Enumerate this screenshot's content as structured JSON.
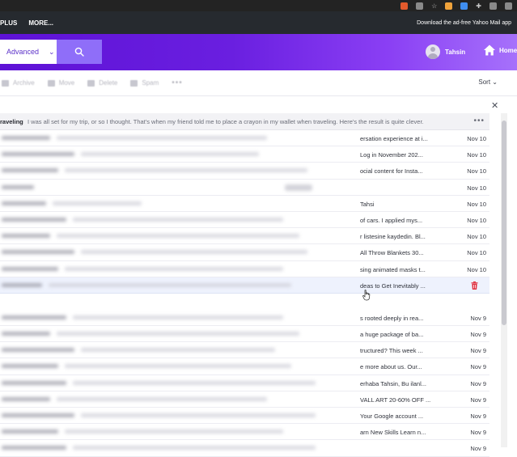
{
  "browser": {
    "icons": [
      "extension-icon",
      "share-icon",
      "star-icon",
      "metamask-icon",
      "pdf-icon",
      "puzzle-icon",
      "window-icon",
      "profile-icon"
    ]
  },
  "nav": {
    "links": [
      "PLUS",
      "MORE..."
    ],
    "ad_free": "Download the ad-free Yahoo Mail app"
  },
  "header": {
    "search_mode": "Advanced",
    "user_name": "Tahsin",
    "home_label": "Home",
    "colors": {
      "start": "#5e12d6",
      "end": "#a671fb",
      "search_button": "#8f6ef9"
    }
  },
  "toolbar": {
    "archive": "Archive",
    "move": "Move",
    "delete": "Delete",
    "spam": "Spam",
    "more": "•••",
    "sort": "Sort"
  },
  "open_message": {
    "subject": "raveling",
    "preview": "I was all set for my trip, or so I thought. That's when my friend told me to place a crayon in my wallet when traveling. Here's the result is quite clever.",
    "more": "•••"
  },
  "messages": [
    {
      "snippet": "ersation experience at i...",
      "date": "Nov 10"
    },
    {
      "snippet": "Log in November 202...",
      "date": "Nov 10"
    },
    {
      "snippet": "ocial content for Insta...",
      "date": "Nov 10"
    },
    {
      "snippet": "",
      "date": "Nov 10"
    },
    {
      "snippet": "Tahsi",
      "date": "Nov 10"
    },
    {
      "snippet": "of cars. I applied mys...",
      "date": "Nov 10"
    },
    {
      "snippet": "r listesine kaydedin. Bl...",
      "date": "Nov 10"
    },
    {
      "snippet": "All Throw Blankets 30...",
      "date": "Nov 10"
    },
    {
      "snippet": "sing animated masks t...",
      "date": "Nov 10"
    },
    {
      "snippet": "deas to Get Inevitably ...",
      "date": ""
    },
    {
      "snippet": "",
      "date": ""
    },
    {
      "snippet": "s rooted deeply in rea...",
      "date": "Nov 9"
    },
    {
      "snippet": "a huge package of ba...",
      "date": "Nov 9"
    },
    {
      "snippet": "tructured? This week ...",
      "date": "Nov 9"
    },
    {
      "snippet": "e more about us. Our...",
      "date": "Nov 9"
    },
    {
      "snippet": "erhaba Tahsin, Bu ilanl...",
      "date": "Nov 9"
    },
    {
      "snippet": "VALL ART 20-60% OFF ...",
      "date": "Nov 9"
    },
    {
      "snippet": "Your Google account ...",
      "date": "Nov 9"
    },
    {
      "snippet": "arn New Skills Learn n...",
      "date": "Nov 9"
    },
    {
      "snippet": "",
      "date": "Nov 9"
    }
  ]
}
